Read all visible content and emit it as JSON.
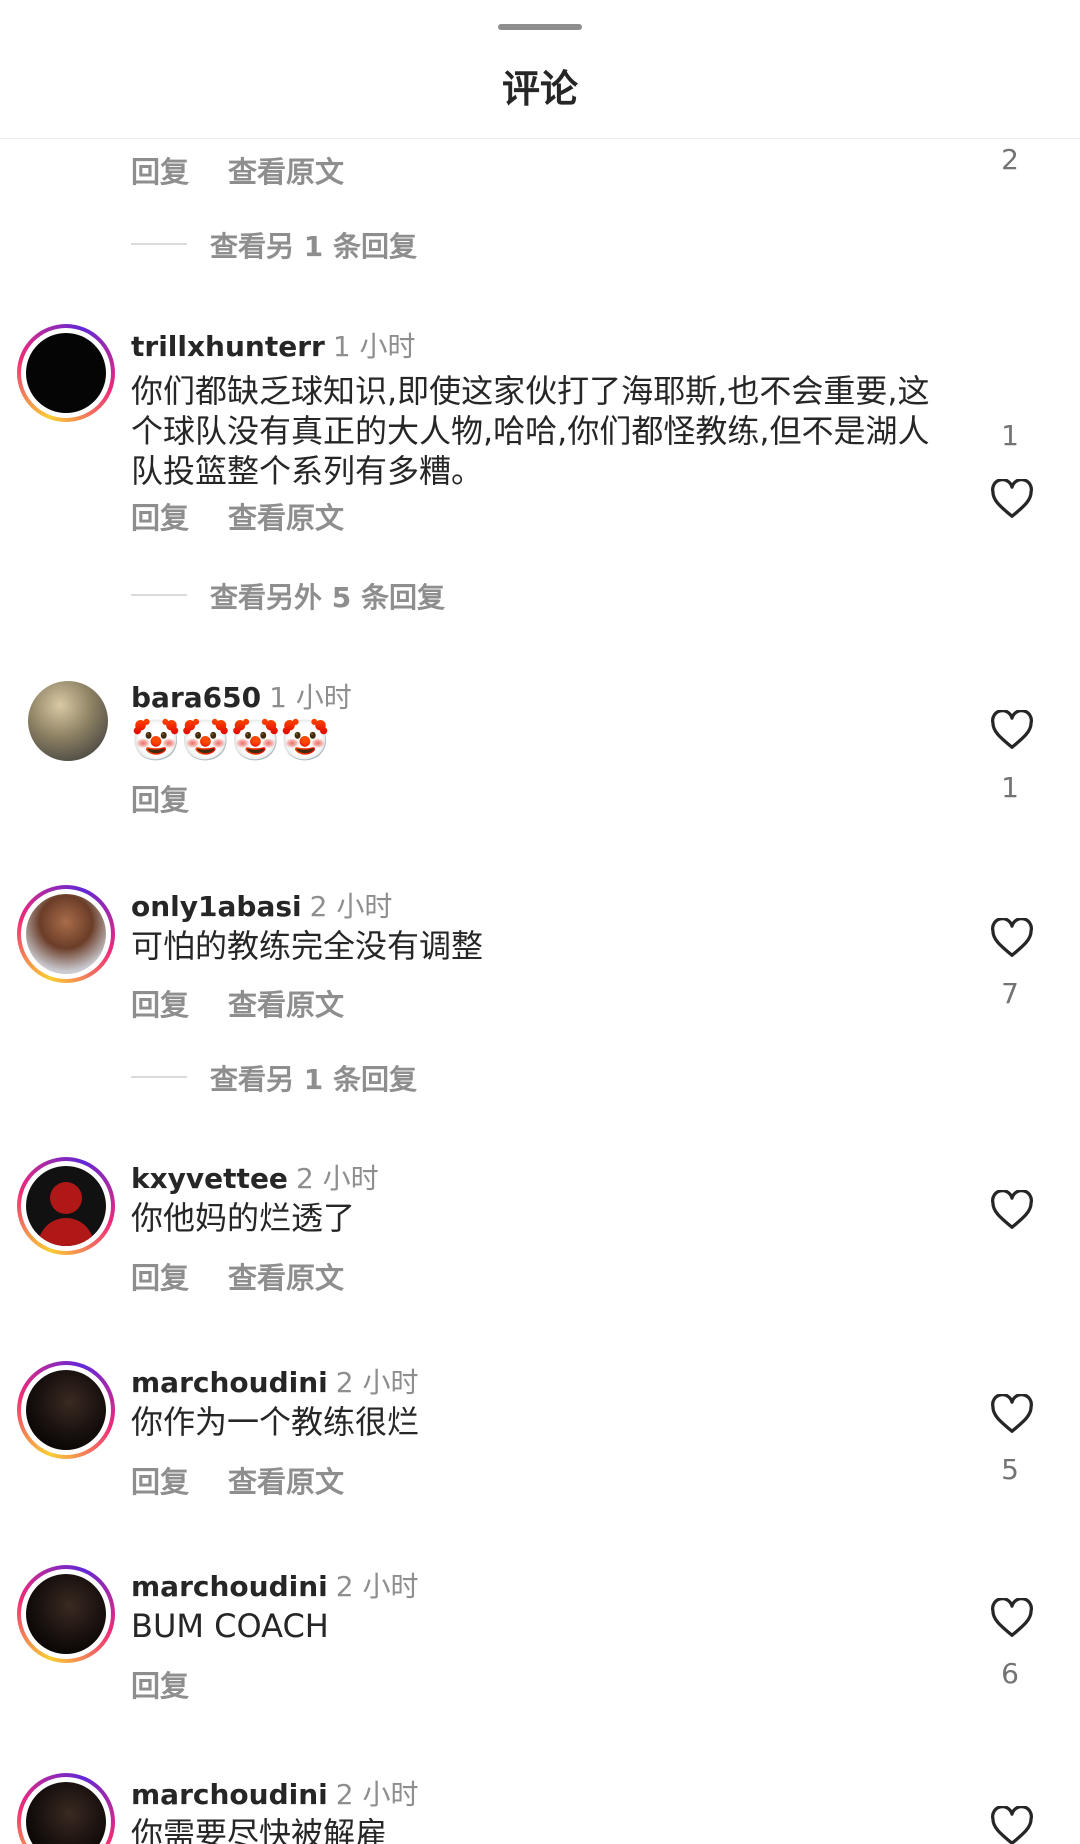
{
  "header": {
    "title": "评论"
  },
  "labels": {
    "reply": "回复",
    "see_translation": "查看原文"
  },
  "top_fragment": {
    "like_count": "2",
    "view_replies": "查看另 1 条回复"
  },
  "comments": [
    {
      "username": "trillxhunterr",
      "time": "1 小时",
      "text": "你们都缺乏球知识,即使这家伙打了海耶斯,也不会重要,这个球队没有真正的大人物,哈哈,你们都怪教练,但不是湖人队投篮整个系列有多糟。",
      "like_count": "1",
      "view_replies": "查看另外 5 条回复"
    },
    {
      "username": "bara650",
      "time": "1 小时",
      "text": "🤡🤡🤡🤡",
      "like_count": "1"
    },
    {
      "username": "only1abasi",
      "time": "2 小时",
      "text": "可怕的教练完全没有调整",
      "like_count": "7",
      "view_replies": "查看另 1 条回复"
    },
    {
      "username": "kxyvettee",
      "time": "2 小时",
      "text": "你他妈的烂透了",
      "like_count": ""
    },
    {
      "username": "marchoudini",
      "time": "2 小时",
      "text": "你作为一个教练很烂",
      "like_count": "5"
    },
    {
      "username": "marchoudini",
      "time": "2 小时",
      "text": "BUM COACH",
      "like_count": "6"
    },
    {
      "username": "marchoudini",
      "time": "2 小时",
      "text": "你需要尽快被解雇",
      "like_count": ""
    }
  ],
  "icons": {
    "like": "heart-outline-icon"
  },
  "colors": {
    "accent_ring_start": "#f9ce34",
    "accent_ring_mid": "#ee2a7b",
    "secondary_text": "#8e8e8e"
  }
}
